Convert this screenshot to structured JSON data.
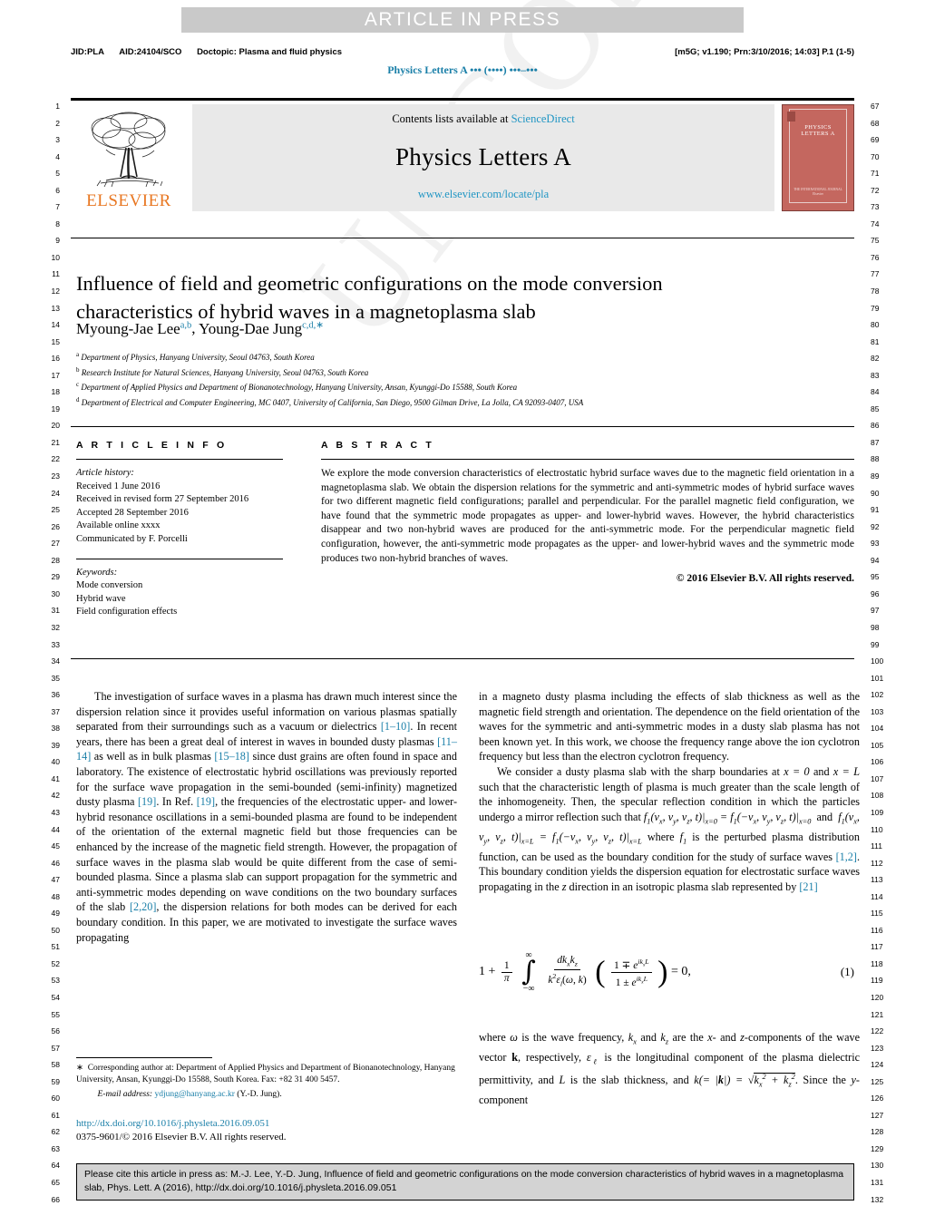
{
  "banner": {
    "text": "ARTICLE IN PRESS"
  },
  "topmeta": {
    "jid": "JID:PLA",
    "aid": "AID:24104/SCO",
    "doctopic": "Doctopic: Plasma and fluid physics",
    "right": "[m5G; v1.190; Prn:3/10/2016; 14:03] P.1 (1-5)"
  },
  "journal_run": "Physics Letters A ••• (••••) •••–•••",
  "masthead": {
    "publisher": "ELSEVIER",
    "contents_prefix": "Contents lists available at ",
    "contents_link": "ScienceDirect",
    "journal_title": "Physics Letters A",
    "journal_url": "www.elsevier.com/locate/pla",
    "cover_title": "PHYSICS LETTERS A",
    "cover_footer": "THE INTERNATIONAL JOURNAL\nElsevier"
  },
  "article": {
    "title": "Influence of field and geometric configurations on the mode conversion characteristics of hybrid waves in a magnetoplasma slab",
    "authors": [
      {
        "name": "Myoung-Jae Lee",
        "marks": "a,b"
      },
      {
        "name": "Young-Dae Jung",
        "marks": "c,d,∗"
      }
    ],
    "affiliations": [
      {
        "mark": "a",
        "text": "Department of Physics, Hanyang University, Seoul 04763, South Korea"
      },
      {
        "mark": "b",
        "text": "Research Institute for Natural Sciences, Hanyang University, Seoul 04763, South Korea"
      },
      {
        "mark": "c",
        "text": "Department of Applied Physics and Department of Bionanotechnology, Hanyang University, Ansan, Kyunggi-Do 15588, South Korea"
      },
      {
        "mark": "d",
        "text": "Department of Electrical and Computer Engineering, MC 0407, University of California, San Diego, 9500 Gilman Drive, La Jolla, CA 92093-0407, USA"
      }
    ]
  },
  "info": {
    "heading": "A R T I C L E    I N F O",
    "history_label": "Article history:",
    "history": [
      "Received 1 June 2016",
      "Received in revised form 27 September 2016",
      "Accepted 28 September 2016",
      "Available online xxxx",
      "Communicated by F. Porcelli"
    ],
    "keywords_label": "Keywords:",
    "keywords": [
      "Mode conversion",
      "Hybrid wave",
      "Field configuration effects"
    ]
  },
  "abstract": {
    "heading": "A B S T R A C T",
    "text": "We explore the mode conversion characteristics of electrostatic hybrid surface waves due to the magnetic field orientation in a magnetoplasma slab. We obtain the dispersion relations for the symmetric and anti-symmetric modes of hybrid surface waves for two different magnetic field configurations; parallel and perpendicular. For the parallel magnetic field configuration, we have found that the symmetric mode propagates as upper- and lower-hybrid waves. However, the hybrid characteristics disappear and two non-hybrid waves are produced for the anti-symmetric mode. For the perpendicular magnetic field configuration, however, the anti-symmetric mode propagates as the upper- and lower-hybrid waves and the symmetric mode produces two non-hybrid branches of waves.",
    "copyright": "© 2016 Elsevier B.V. All rights reserved."
  },
  "body": {
    "left_para1_a": "The investigation of surface waves in a plasma has drawn much interest since the dispersion relation since it provides useful information on various plasmas spatially separated from their surroundings such as a vacuum or dielectrics ",
    "cite_1_10": "[1–10]",
    "left_para1_b": ". In recent years, there has been a great deal of interest in waves in bounded dusty plasmas ",
    "cite_11_14": "[11–14]",
    "left_para1_c": " as well as in bulk plasmas ",
    "cite_15_18": "[15–18]",
    "left_para1_d": " since dust grains are often found in space and laboratory. The existence of electrostatic hybrid oscillations was previously reported for the surface wave propagation in the semi-bounded (semi-infinity) magnetized dusty plasma ",
    "cite_19a": "[19]",
    "left_para1_e": ". In Ref. ",
    "cite_19b": "[19]",
    "left_para1_f": ", the frequencies of the electrostatic upper- and lower-hybrid resonance oscillations in a semi-bounded plasma are found to be independent of the orientation of the external magnetic field but those frequencies can be enhanced by the increase of the magnetic field strength. However, the propagation of surface waves in the plasma slab would be quite different from the case of semi-bounded plasma. Since a plasma slab can support propagation for the symmetric and anti-symmetric modes depending on wave conditions on the two boundary surfaces of the slab ",
    "cite_2_20": "[2,20]",
    "left_para1_g": ", the dispersion relations for both modes can be derived for each boundary condition. In this paper, we are motivated to investigate the surface waves propagating",
    "right_para1": "in a magneto dusty plasma including the effects of slab thickness as well as the magnetic field strength and orientation. The dependence on the field orientation of the waves for the symmetric and anti-symmetric modes in a dusty slab plasma has not been known yet. In this work, we choose the frequency range above the ion cyclotron frequency but less than the electron cyclotron frequency.",
    "right_para2_a": "We consider a dusty plasma slab with the sharp boundaries at ",
    "right_para2_b": " and ",
    "right_para2_c": " such that the characteristic length of plasma is much greater than the scale length of the inhomogeneity. Then, the specular reflection condition in which the particles undergo a mirror reflection such that ",
    "right_para2_d": " where ",
    "right_para2_e": " is the perturbed plasma distribution function, can be used as the boundary condition for the study of surface waves ",
    "cite_1_2": "[1,2]",
    "right_para2_f": ". This boundary condition yields the dispersion equation for electrostatic surface waves propagating in the ",
    "right_para2_g": " direction in an isotropic plasma slab represented by ",
    "cite_21": "[21]",
    "right_para3_a": "where ",
    "right_para3_b": " is the wave frequency, ",
    "right_para3_c": " and ",
    "right_para3_d": " are the ",
    "right_para3_e": "- and ",
    "right_para3_f": "-components of the wave vector ",
    "right_para3_g": ", respectively, ",
    "right_para3_h": " is the longitudinal component of the plasma dielectric permittivity, and ",
    "right_para3_i": " is the slab thickness, and ",
    "right_para3_j": ". Since the ",
    "right_para3_k": "-component"
  },
  "equation": {
    "number": "(1)",
    "limit_upper": "∞",
    "limit_lower": "−∞"
  },
  "footnote": {
    "marker": "∗",
    "text": "Corresponding author at: Department of Applied Physics and Department of Bionanotechnology, Hanyang University, Ansan, Kyunggi-Do 15588, South Korea. Fax: +82 31 400 5457.",
    "email_label": "E-mail address:",
    "email": "ydjung@hanyang.ac.kr",
    "email_suffix": "(Y.-D. Jung)."
  },
  "doi": {
    "url": "http://dx.doi.org/10.1016/j.physleta.2016.09.051",
    "issn_line": "0375-9601/© 2016 Elsevier B.V. All rights reserved."
  },
  "cite_box": {
    "text": "Please cite this article in press as: M.-J. Lee, Y.-D. Jung, Influence of field and geometric configurations on the mode conversion characteristics of hybrid waves in a magnetoplasma slab, Phys. Lett. A (2016), http://dx.doi.org/10.1016/j.physleta.2016.09.051"
  },
  "line_numbers": {
    "left_start": 1,
    "left_end": 66,
    "right_start": 67,
    "right_end": 132
  },
  "watermark": "UNCORRECTED PROOF",
  "colors": {
    "link": "#1a7fa8",
    "elsevier_orange": "#e87722",
    "sciencedirect": "#2196c4",
    "banner_bg": "#c9c9c9",
    "masthead_bg": "#e9e9e9",
    "cover_red": "#c4675f",
    "cite_box_bg": "#d3d3d3"
  }
}
